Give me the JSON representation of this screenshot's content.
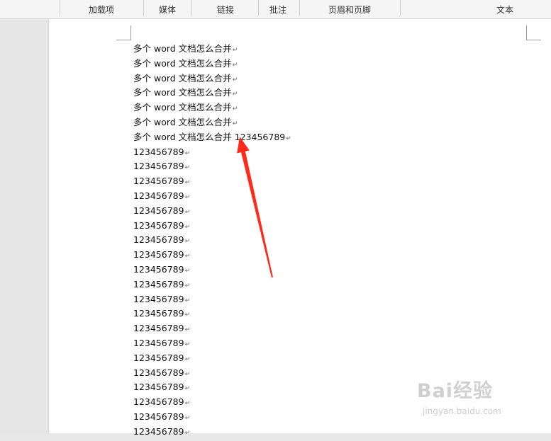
{
  "ribbon": {
    "groups": [
      "加载项",
      "媒体",
      "链接",
      "批注",
      "页眉和页脚",
      "文本"
    ]
  },
  "document": {
    "pilcrow": "↵",
    "lines": [
      "多个 word 文档怎么合并",
      "多个 word 文档怎么合并",
      "多个 word 文档怎么合并",
      "多个 word 文档怎么合并",
      "多个 word 文档怎么合并",
      "多个 word 文档怎么合并",
      "多个 word 文档怎么合并 123456789",
      "123456789",
      "123456789",
      "123456789",
      "123456789",
      "123456789",
      "123456789",
      "123456789",
      "123456789",
      "123456789",
      "123456789",
      "123456789",
      "123456789",
      "123456789",
      "123456789",
      "123456789",
      "123456789",
      "123456789",
      "123456789",
      "123456789",
      "123456789"
    ]
  },
  "annotation": {
    "arrow_color": "#ff2a1a"
  },
  "watermark": {
    "brand": "Bai经验",
    "url": "jingyan.baidu.com"
  }
}
